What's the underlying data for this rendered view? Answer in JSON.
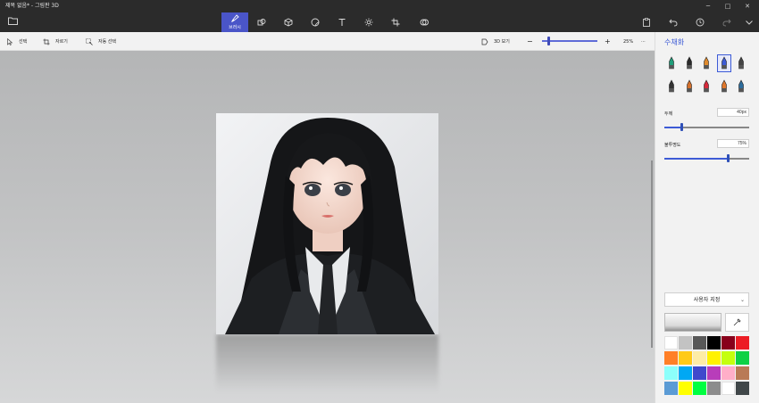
{
  "window": {
    "title": "제목 없음* - 그림판 3D",
    "minimize_glyph": "─",
    "maximize_glyph": "□",
    "close_glyph": "✕"
  },
  "ribbon": {
    "active_tool_label": "브러시",
    "tools": [
      {
        "name": "brushes",
        "icon": "brush-icon",
        "label": "브러시",
        "active": true
      },
      {
        "name": "2d-shapes",
        "icon": "shapes-2d-icon"
      },
      {
        "name": "3d-shapes",
        "icon": "cube-icon"
      },
      {
        "name": "stickers",
        "icon": "sticker-icon"
      },
      {
        "name": "text",
        "icon": "text-icon"
      },
      {
        "name": "effects",
        "icon": "effects-icon"
      },
      {
        "name": "canvas",
        "icon": "canvas-crop-icon"
      },
      {
        "name": "3d-library",
        "icon": "library-icon"
      }
    ],
    "right_icons": [
      "paste-icon",
      "undo-icon",
      "history-icon",
      "redo-icon",
      "expand-chevron-icon"
    ]
  },
  "subbar": {
    "select_label": "선택",
    "crop_label": "자르기",
    "magic_select_label": "자동 선택",
    "view3d_label": "3D 보기",
    "zoom_minus": "−",
    "zoom_plus": "+",
    "zoom_level": "25%",
    "more_glyph": "···",
    "zoom_fraction": 0.12
  },
  "panel": {
    "title": "수채화",
    "brushes": [
      {
        "name": "marker",
        "color": "#1f9e7a"
      },
      {
        "name": "calligraphy-pen",
        "color": "#2a2a2a"
      },
      {
        "name": "oil-brush",
        "color": "#e08a2c"
      },
      {
        "name": "watercolor",
        "color": "#3d5bd6",
        "selected": true
      },
      {
        "name": "pixel-pen",
        "color": "#444"
      },
      {
        "name": "pencil",
        "color": "#333"
      },
      {
        "name": "eraser",
        "color": "#d4702c"
      },
      {
        "name": "crayon",
        "color": "#d8283a"
      },
      {
        "name": "spray-can",
        "color": "#e0782c"
      },
      {
        "name": "fill",
        "color": "#2c6c9c"
      }
    ],
    "thickness_label": "두께",
    "thickness_value": "40px",
    "thickness_fraction": 0.2,
    "opacity_label": "불투명도",
    "opacity_value": "75%",
    "opacity_fraction": 0.75,
    "color_mode": "사용자 지정",
    "current_color": "#ffffff",
    "palette": [
      "#ffffff",
      "#c3c3c3",
      "#585858",
      "#000000",
      "#88001b",
      "#ec1c24",
      "#ff7f27",
      "#ffca18",
      "#fdeca6",
      "#fff200",
      "#c4ff0e",
      "#0ed145",
      "#8cfffb",
      "#00a8f3",
      "#3f48cc",
      "#b83dba",
      "#ffaec8",
      "#b97a56",
      "#5b9bd5",
      "#ffff00",
      "#00ff41",
      "#8c8c8c",
      "#ffffff",
      "#404749"
    ]
  }
}
